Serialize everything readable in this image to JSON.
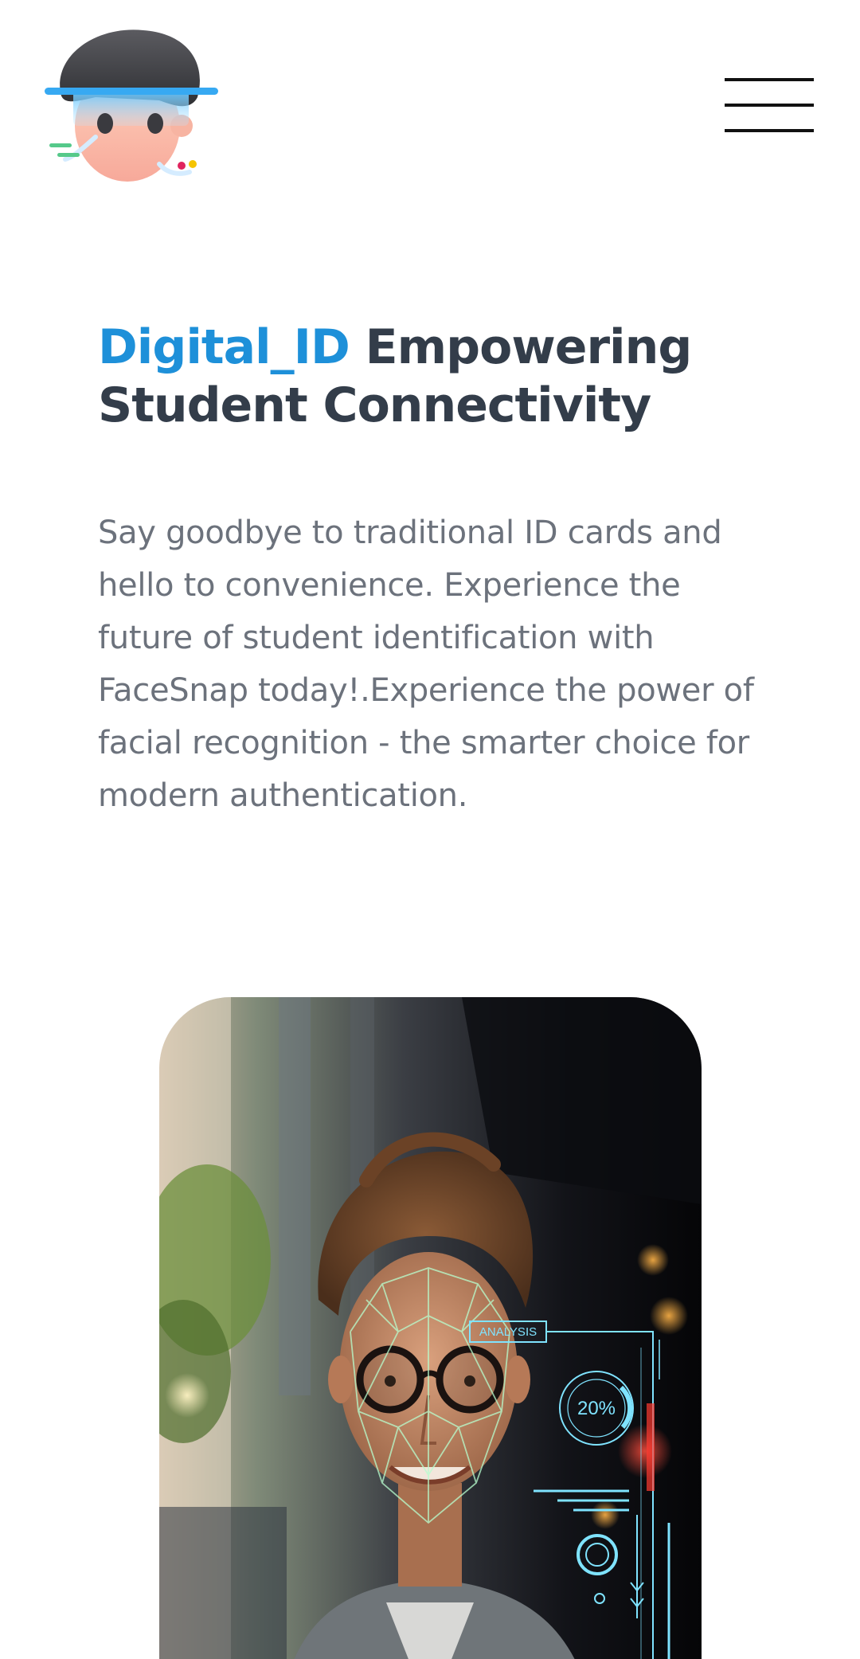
{
  "header": {
    "logo_icon": "face-scan-avatar-icon",
    "menu_icon": "hamburger-menu-icon"
  },
  "hero": {
    "title_brand": "Digital_ID",
    "title_rest": " Empowering Student Connectivity",
    "description": "Say goodbye to traditional ID cards and hello to convenience. Experience the future of student identification with FaceSnap today!.Experience the power of facial recognition - the smarter choice for modern authentication."
  },
  "image_overlay": {
    "analysis_label": "ANALYSIS",
    "percent_label": "20%"
  },
  "colors": {
    "brand_blue": "#1e90d9",
    "heading": "#333d4a",
    "body_text": "#6c727c",
    "hud_cyan": "#7fe3ff"
  }
}
